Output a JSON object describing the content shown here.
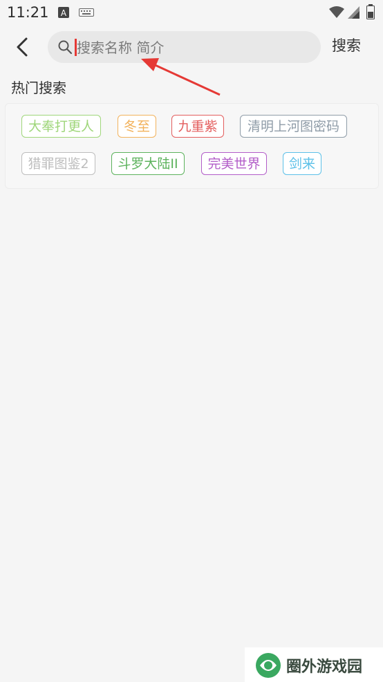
{
  "status_bar": {
    "time": "11:21",
    "icons": [
      "notification-a-icon",
      "keyboard-icon",
      "wifi-icon",
      "signal-icon",
      "battery-icon"
    ]
  },
  "header": {
    "search": {
      "value": "",
      "placeholder": "搜索名称 简介"
    },
    "search_button_label": "搜索"
  },
  "hot_search": {
    "title": "热门搜索",
    "tags": [
      {
        "label": "大奉打更人",
        "color": "#9fd67a"
      },
      {
        "label": "冬至",
        "color": "#f2b25c"
      },
      {
        "label": "九重紫",
        "color": "#e35d5d"
      },
      {
        "label": "清明上河图密码",
        "color": "#8f9ca8"
      },
      {
        "label": "猎罪图鉴2",
        "color": "#bdbdbd"
      },
      {
        "label": "斗罗大陆II",
        "color": "#5cb25c"
      },
      {
        "label": "完美世界",
        "color": "#b25cc8"
      },
      {
        "label": "剑来",
        "color": "#5cc0e8"
      }
    ]
  },
  "watermark": {
    "text": "圈外游戏园"
  },
  "colors": {
    "annotation_arrow": "#e53935",
    "caret": "#e53935"
  }
}
